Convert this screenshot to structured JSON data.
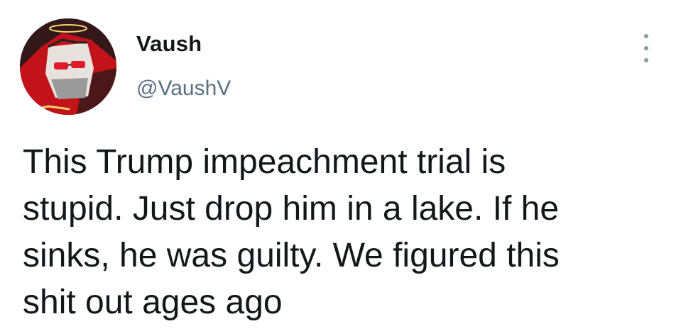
{
  "tweet": {
    "author": {
      "display_name": "Vaush",
      "handle": "@VaushV",
      "avatar_icon": "avatar-illustration"
    },
    "more_icon": "more-vertical-icon",
    "text": "This Trump impeachment trial is\nstupid. Just drop him in a lake. If he\nsinks, he was guilty. We figured this\nshit out ages ago"
  },
  "colors": {
    "text_primary": "#14171a",
    "text_secondary": "#5b7083",
    "icon_gray": "#8899a6",
    "avatar_red": "#c2121a",
    "background": "#ffffff"
  }
}
